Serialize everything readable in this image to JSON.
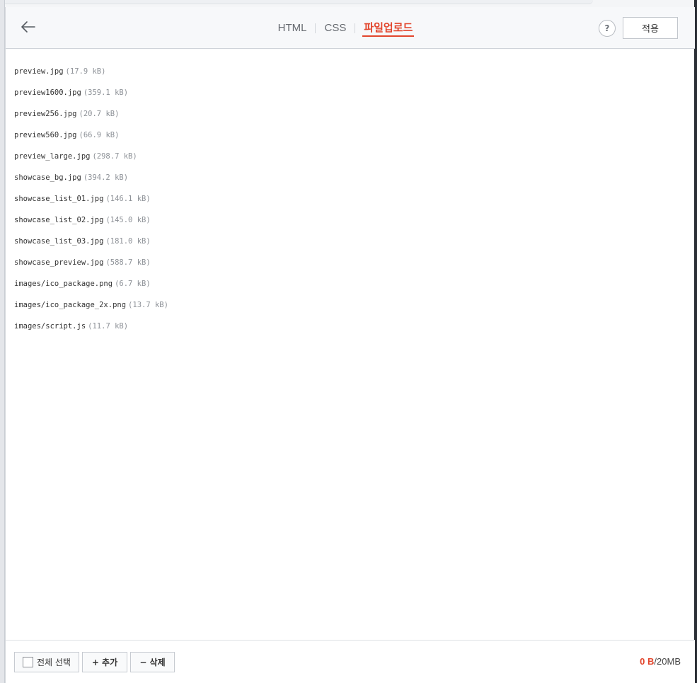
{
  "header": {
    "tabs": [
      {
        "label": "HTML",
        "active": false
      },
      {
        "label": "CSS",
        "active": false
      },
      {
        "label": "파일업로드",
        "active": true
      }
    ],
    "help_label": "?",
    "apply_label": "적용"
  },
  "files": [
    {
      "name": "preview.jpg",
      "size": "(17.9 kB)"
    },
    {
      "name": "preview1600.jpg",
      "size": "(359.1 kB)"
    },
    {
      "name": "preview256.jpg",
      "size": "(20.7 kB)"
    },
    {
      "name": "preview560.jpg",
      "size": "(66.9 kB)"
    },
    {
      "name": "preview_large.jpg",
      "size": "(298.7 kB)"
    },
    {
      "name": "showcase_bg.jpg",
      "size": "(394.2 kB)"
    },
    {
      "name": "showcase_list_01.jpg",
      "size": "(146.1 kB)"
    },
    {
      "name": "showcase_list_02.jpg",
      "size": "(145.0 kB)"
    },
    {
      "name": "showcase_list_03.jpg",
      "size": "(181.0 kB)"
    },
    {
      "name": "showcase_preview.jpg",
      "size": "(588.7 kB)"
    },
    {
      "name": "images/ico_package.png",
      "size": "(6.7 kB)"
    },
    {
      "name": "images/ico_package_2x.png",
      "size": "(13.7 kB)"
    },
    {
      "name": "images/script.js",
      "size": "(11.7 kB)"
    }
  ],
  "footer": {
    "select_all_label": "전체 선택",
    "add_label": "+ 추가",
    "delete_label": "− 삭제",
    "used": "0 B",
    "separator": "/",
    "limit": "20MB"
  },
  "colors": {
    "accent": "#e2452c",
    "text": "#333333",
    "muted": "#8d9197"
  }
}
